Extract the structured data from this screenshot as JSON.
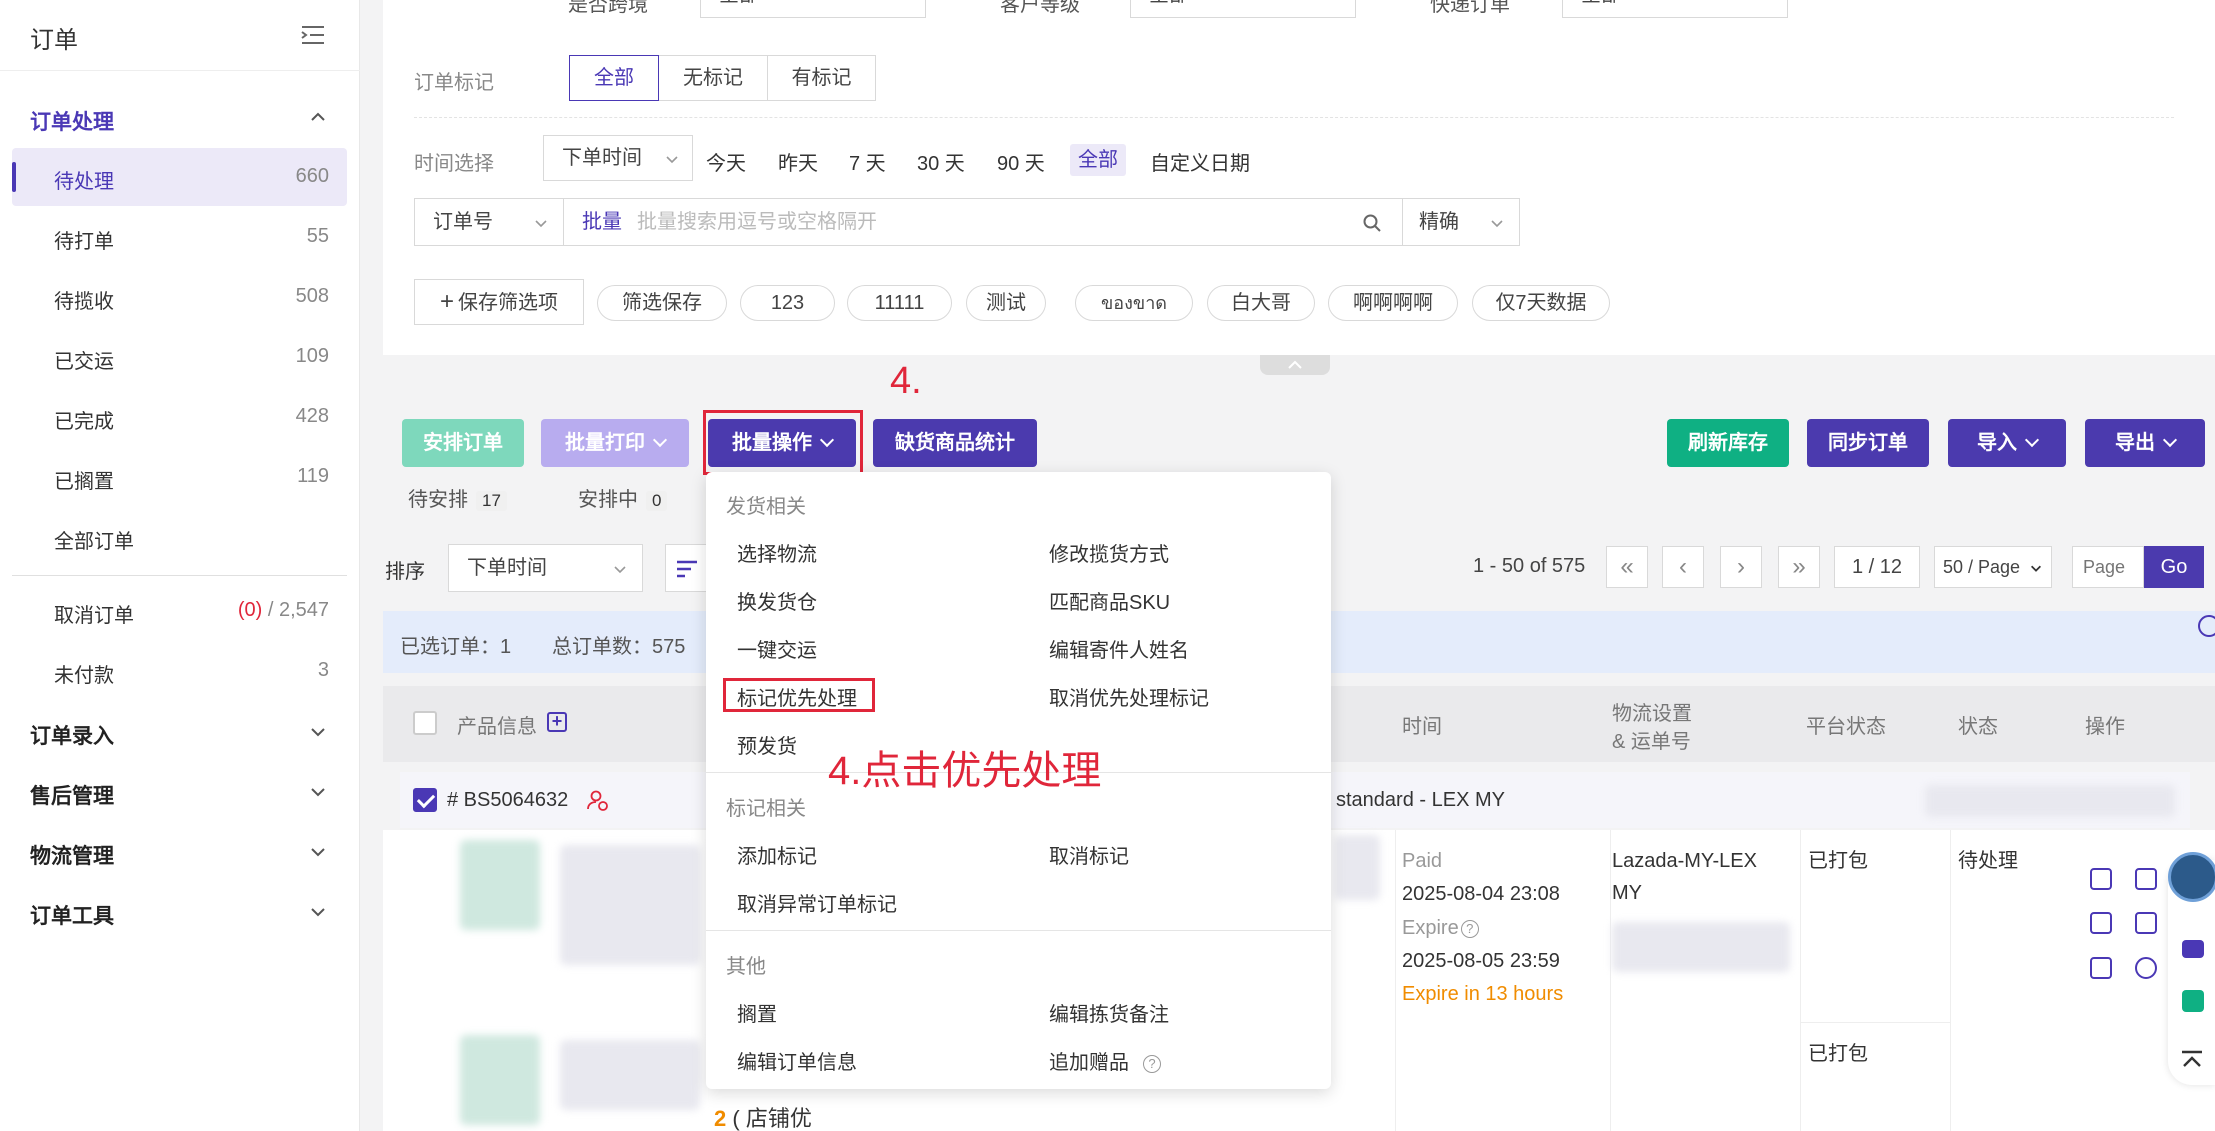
{
  "sidebar": {
    "title": "订单",
    "groups": [
      {
        "label": "订单处理"
      },
      {
        "label": "订单录入"
      },
      {
        "label": "售后管理"
      },
      {
        "label": "物流管理"
      },
      {
        "label": "订单工具"
      }
    ],
    "items": [
      {
        "label": "待处理",
        "count": "660"
      },
      {
        "label": "待打单",
        "count": "55"
      },
      {
        "label": "待揽收",
        "count": "508"
      },
      {
        "label": "已交运",
        "count": "109"
      },
      {
        "label": "已完成",
        "count": "428"
      },
      {
        "label": "已搁置",
        "count": "119"
      },
      {
        "label": "全部订单",
        "count": ""
      },
      {
        "label": "取消订单",
        "count_red": "(0)",
        "count": " / 2,547"
      },
      {
        "label": "未付款",
        "count": "3"
      }
    ]
  },
  "filters": {
    "top_row": [
      {
        "label": "是否跨境",
        "value": "全部"
      },
      {
        "label": "客户等级",
        "value": "全部"
      },
      {
        "label": "快递订单",
        "value": "全部"
      }
    ],
    "mark_label": "订单标记",
    "mark_options": [
      "全部",
      "无标记",
      "有标记"
    ],
    "time_label": "时间选择",
    "time_type": "下单时间",
    "time_links": [
      "今天",
      "昨天",
      "7 天",
      "30 天",
      "90 天",
      "全部",
      "自定义日期"
    ],
    "search_field": "订单号",
    "batch_label": "批量",
    "search_placeholder": "批量搜索用逗号或空格隔开",
    "match_mode": "精确",
    "save_filter": "保存筛选项",
    "saved_chips": [
      "筛选保存",
      "123",
      "11111",
      "测试",
      "ของขาด",
      "白大哥",
      "啊啊啊啊",
      "仅7天数据"
    ]
  },
  "toolbar": {
    "arrange": "安排订单",
    "batch_print": "批量打印",
    "batch_ops": "批量操作",
    "shortage": "缺货商品统计",
    "refresh_stock": "刷新库存",
    "sync_orders": "同步订单",
    "import": "导入",
    "export": "导出",
    "pending_arrange_label": "待安排",
    "pending_arrange_count": "17",
    "arranging_label": "安排中",
    "arranging_count": "0",
    "step_label": "4."
  },
  "sort": {
    "label": "排序",
    "value": "下单时间",
    "range": "1 - 50 of 575",
    "page": "1 / 12",
    "page_size": "50 / Page",
    "page_placeholder": "Page",
    "go": "Go"
  },
  "info": {
    "selected": "已选订单：1",
    "total": "总订单数：575"
  },
  "table": {
    "headers": [
      "产品信息",
      "时间",
      "物流设置",
      "& 运单号",
      "平台状态",
      "状态",
      "操作"
    ],
    "order_no": "# BS5064632",
    "shipping": "standard - LEX MY",
    "paid": "Paid",
    "paid_time": "2025-08-04 23:08",
    "expire": "Expire",
    "expire_time": "2025-08-05 23:59",
    "expire_in": "Expire in 13 hours",
    "logistics": "Lazada-MY-LEX MY",
    "platform_status": "已打包",
    "platform_status2": "已打包",
    "status": "待处理",
    "qty_prefix": "2",
    "qty_text": "( 店铺优"
  },
  "dropdown": {
    "section1": "发货相关",
    "s1_items": [
      "选择物流",
      "修改揽货方式",
      "换发货仓",
      "匹配商品SKU",
      "一键交运",
      "编辑寄件人姓名",
      "标记优先处理",
      "取消优先处理标记",
      "预发货"
    ],
    "section2": "标记相关",
    "s2_items": [
      "添加标记",
      "取消标记",
      "取消异常订单标记"
    ],
    "section3": "其他",
    "s3_items": [
      "搁置",
      "编辑拣货备注",
      "编辑订单信息",
      "追加赠品"
    ]
  },
  "annotation": "4.点击优先处理",
  "colors": {
    "accent": "#4b3aae",
    "green": "#0fb083",
    "red": "#e0263a"
  }
}
